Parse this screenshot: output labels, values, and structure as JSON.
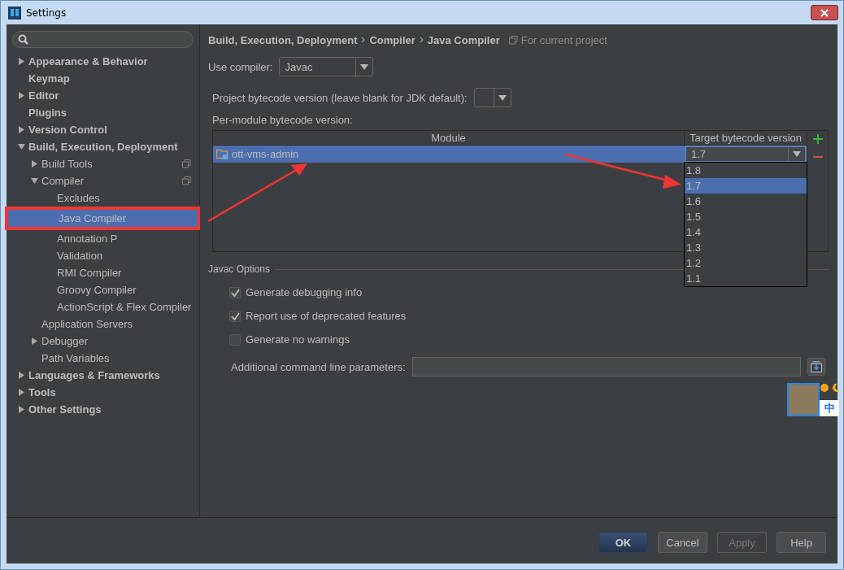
{
  "window": {
    "title": "Settings"
  },
  "sidebar": {
    "items": [
      {
        "label": "Appearance & Behavior",
        "expanded": false,
        "selected": false,
        "project_scoped": false
      },
      {
        "label": "Keymap",
        "selected": false,
        "project_scoped": false
      },
      {
        "label": "Editor",
        "expanded": false,
        "selected": false,
        "project_scoped": false
      },
      {
        "label": "Plugins",
        "selected": false,
        "project_scoped": false
      },
      {
        "label": "Version Control",
        "expanded": false,
        "selected": false,
        "project_scoped": false
      },
      {
        "label": "Build, Execution, Deployment",
        "expanded": true,
        "selected": false,
        "project_scoped": false,
        "children": [
          {
            "label": "Build Tools",
            "expanded": false,
            "selected": false,
            "project_scoped": true
          },
          {
            "label": "Compiler",
            "expanded": true,
            "selected": false,
            "project_scoped": true,
            "children": [
              {
                "label": "Excludes",
                "selected": false,
                "project_scoped": false
              },
              {
                "label": "Java Compiler",
                "selected": true,
                "project_scoped": false
              },
              {
                "label": "Annotation P",
                "selected": false,
                "project_scoped": false
              },
              {
                "label": "Validation",
                "selected": false,
                "project_scoped": false
              },
              {
                "label": "RMI Compiler",
                "selected": false,
                "project_scoped": false
              },
              {
                "label": "Groovy Compiler",
                "selected": false,
                "project_scoped": false
              },
              {
                "label": "ActionScript & Flex Compiler",
                "selected": false,
                "project_scoped": false
              }
            ]
          },
          {
            "label": "Application Servers",
            "selected": false,
            "project_scoped": false
          },
          {
            "label": "Debugger",
            "expanded": false,
            "selected": false,
            "project_scoped": false
          },
          {
            "label": "Path Variables",
            "selected": false,
            "project_scoped": false
          }
        ]
      },
      {
        "label": "Languages & Frameworks",
        "expanded": false,
        "selected": false,
        "project_scoped": false
      },
      {
        "label": "Tools",
        "expanded": false,
        "selected": false,
        "project_scoped": false
      },
      {
        "label": "Other Settings",
        "expanded": false,
        "selected": false,
        "project_scoped": false
      }
    ]
  },
  "breadcrumb": [
    "Build, Execution, Deployment",
    "Compiler",
    "Java Compiler"
  ],
  "scope_note": "For current project",
  "use_compiler": {
    "label": "Use compiler:",
    "value": "Javac"
  },
  "project_bytecode": {
    "label": "Project bytecode version (leave blank for JDK default):"
  },
  "per_module": {
    "label": "Per-module bytecode version:",
    "columns": [
      "Module",
      "Target bytecode version"
    ],
    "rows": [
      {
        "module": "ott-vms-admin",
        "target": "1.7",
        "selected": true
      }
    ],
    "dropdown_options": [
      {
        "label": "1.8",
        "selected": false
      },
      {
        "label": "1.7",
        "selected": true
      },
      {
        "label": "1.6",
        "selected": false
      },
      {
        "label": "1.5",
        "selected": false
      },
      {
        "label": "1.4",
        "selected": false
      },
      {
        "label": "1.3",
        "selected": false
      },
      {
        "label": "1.2",
        "selected": false
      },
      {
        "label": "1.1",
        "selected": false
      }
    ]
  },
  "javac_options": {
    "title": "Javac Options",
    "checkboxes": [
      {
        "label": "Generate debugging info",
        "checked": true
      },
      {
        "label": "Report use of deprecated features",
        "checked": true
      },
      {
        "label": "Generate no warnings",
        "checked": false
      }
    ],
    "additional_label": "Additional command line parameters:"
  },
  "ime_toolbar": {
    "label": "中"
  },
  "buttons": [
    {
      "label": "OK",
      "primary": true,
      "disabled": false
    },
    {
      "label": "Cancel",
      "primary": false,
      "disabled": false
    },
    {
      "label": "Apply",
      "primary": false,
      "disabled": true
    },
    {
      "label": "Help",
      "primary": false,
      "disabled": false
    }
  ]
}
